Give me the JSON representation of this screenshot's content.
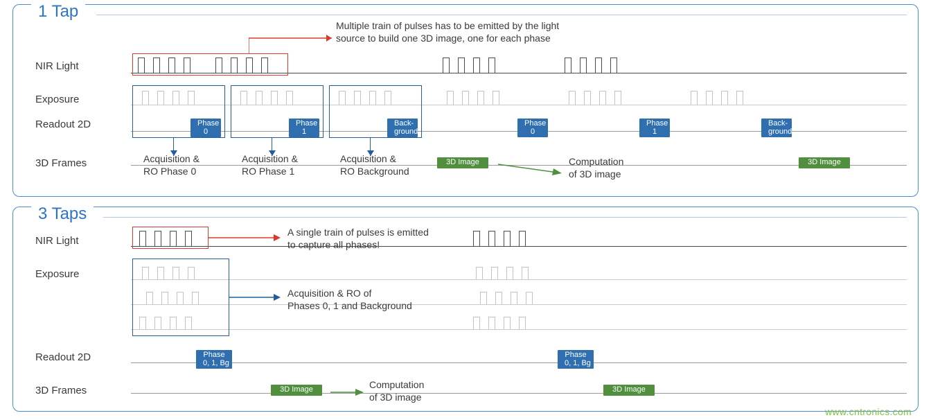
{
  "chart_data": {
    "type": "diagram",
    "title": "Comparison of 1-Tap vs 3-Tap indirect ToF acquisition timing",
    "panels": [
      {
        "name": "1 Tap",
        "rows": [
          "NIR Light",
          "Exposure",
          "Readout 2D",
          "3D Frames"
        ],
        "annotation": "Multiple train of pulses has to be emitted by the light source to build one 3D image, one for each phase",
        "phase_boxes": [
          {
            "label": "Phase\n0",
            "caption": "Acquisition &\nRO Phase 0"
          },
          {
            "label": "Phase\n1",
            "caption": "Acquisition &\nRO Phase 1"
          },
          {
            "label": "Back-\nground",
            "caption": "Acquisition &\nRO Background"
          }
        ],
        "second_cycle_readout": [
          "Phase\n0",
          "Phase\n1",
          "Back-\nground"
        ],
        "frames": [
          "3D Image",
          "3D Image"
        ],
        "compute_label": "Computation\nof 3D image"
      },
      {
        "name": "3 Taps",
        "rows": [
          "NIR Light",
          "Exposure",
          "Readout 2D",
          "3D Frames"
        ],
        "annotation": "A single train of pulses is emitted to capture all phases!",
        "phase_boxes": [
          {
            "label": "Phase\n0, 1, Bg",
            "caption": "Acquisition & RO of\nPhases 0, 1 and Background"
          }
        ],
        "second_cycle_readout": [
          "Phase\n0, 1, Bg"
        ],
        "frames": [
          "3D Image",
          "3D Image"
        ],
        "compute_label": "Computation\nof 3D image"
      }
    ]
  },
  "p1": {
    "title": "1 Tap",
    "labels": {
      "nir": "NIR Light",
      "exp": "Exposure",
      "ro": "Readout 2D",
      "frm": "3D Frames"
    },
    "note": "Multiple train of pulses has to be emitted by the light\nsource to build one 3D image, one for each phase",
    "ph0": "Phase\n0",
    "ph1": "Phase\n1",
    "phbg": "Back-\nground",
    "cap0": "Acquisition &\nRO Phase 0",
    "cap1": "Acquisition &\nRO Phase 1",
    "capbg": "Acquisition &\nRO Background",
    "img": "3D Image",
    "compute": "Computation\nof 3D image"
  },
  "p2": {
    "title": "3 Taps",
    "labels": {
      "nir": "NIR Light",
      "exp": "Exposure",
      "ro": "Readout 2D",
      "frm": "3D Frames"
    },
    "note": "A single train of pulses is emitted\nto capture all phases!",
    "cap": "Acquisition & RO of\nPhases 0, 1 and Background",
    "ph": "Phase\n0, 1, Bg",
    "img": "3D Image",
    "compute": "Computation\nof 3D image"
  },
  "watermark": "www.cntronics.com"
}
